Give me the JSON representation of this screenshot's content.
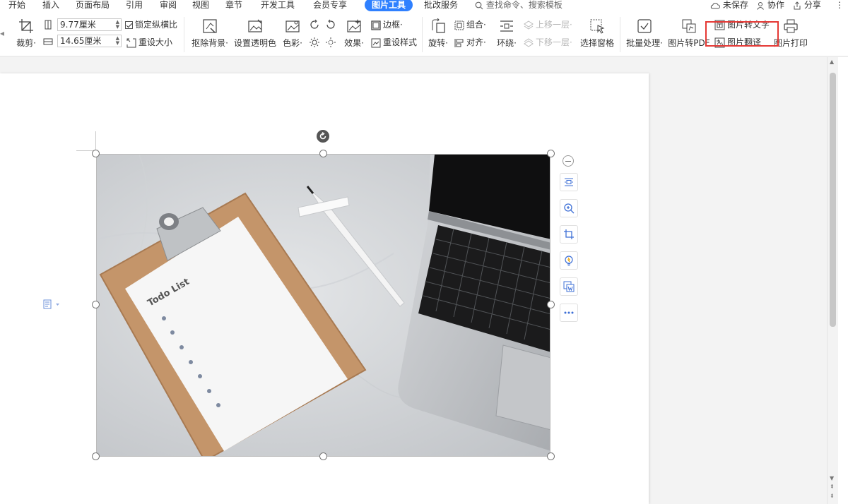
{
  "menu": {
    "items": [
      "开始",
      "插入",
      "页面布局",
      "引用",
      "审阅",
      "视图",
      "章节",
      "开发工具",
      "会员专享"
    ],
    "active": "图片工具",
    "after_active": "批改服务",
    "search_placeholder": "查找命令、搜索模板"
  },
  "top_right": {
    "unsaved": "未保存",
    "collab": "协作",
    "share": "分享"
  },
  "ribbon": {
    "crop": "裁剪",
    "width_value": "9.77厘米",
    "height_value": "14.65厘米",
    "lock_ratio": "锁定纵横比",
    "reset_size": "重设大小",
    "remove_bg": "抠除背景",
    "set_transparent": "设置透明色",
    "color": "色彩",
    "effects": "效果",
    "border": "边框",
    "reset_style": "重设样式",
    "rotate": "旋转",
    "group": "组合",
    "align": "对齐",
    "wrap": "环绕",
    "bring_forward": "上移一层",
    "send_backward": "下移一层",
    "selection_pane": "选择窗格",
    "batch": "批量处理",
    "to_pdf": "图片转PDF",
    "to_text": "图片转文字",
    "translate": "图片翻译",
    "print": "图片打印"
  },
  "photo": {
    "clipboard_title": "Todo List"
  },
  "colors": {
    "accent": "#2f80ff",
    "highlight": "#e53935"
  }
}
